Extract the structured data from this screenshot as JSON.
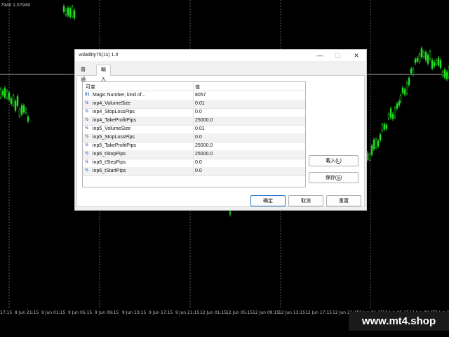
{
  "chart": {
    "top_info": "7940 1.07949",
    "time_labels": [
      "17:15",
      "8 Jun 21:15",
      "9 Jun 01:15",
      "9 Jun 05:15",
      "9 Jun 09:15",
      "9 Jun 13:15",
      "9 Jun 17:15",
      "9 Jun 21:15",
      "12 Jun 01:15",
      "12 Jun 05:15",
      "12 Jun 09:15",
      "12 Jun 13:15",
      "12 Jun 17:15",
      "12 Jun 21:15",
      "13 Jun 01:15",
      "13 Jun 05:15",
      "13 Jun 09:15",
      "13 Jun 13:15"
    ],
    "watermark": "www.mt4.shop",
    "candle_color": "#22dd22"
  },
  "dialog": {
    "title": "volatility75(1s) 1.0",
    "window_controls": {
      "minimize": "—",
      "maximize": "☐",
      "close": "✕"
    },
    "tabs": [
      "普通",
      "輸入"
    ],
    "table": {
      "col_variable": "可变",
      "col_value": "值",
      "rows": [
        {
          "icon": "01",
          "name": "Magic Number, kind of...",
          "value": "8057"
        },
        {
          "icon": "½",
          "name": "inp4_VolumeSize",
          "value": "0.01"
        },
        {
          "icon": "½",
          "name": "inp4_StopLossPips",
          "value": "0.0"
        },
        {
          "icon": "½",
          "name": "inp4_TakeProfitPips",
          "value": "25000.0"
        },
        {
          "icon": "½",
          "name": "inp5_VolumeSize",
          "value": "0.01"
        },
        {
          "icon": "½",
          "name": "inp5_StopLossPips",
          "value": "0.0"
        },
        {
          "icon": "½",
          "name": "inp5_TakeProfitPips",
          "value": "25000.0"
        },
        {
          "icon": "½",
          "name": "inp6_tStopPips",
          "value": "25000.0"
        },
        {
          "icon": "½",
          "name": "inp6_tStepPips",
          "value": "0.0"
        },
        {
          "icon": "½",
          "name": "inp6_tStartPips",
          "value": "0.0"
        }
      ]
    },
    "buttons": {
      "load_prefix": "載入(",
      "load_key": "L",
      "load_suffix": ")",
      "save_prefix": "保存(",
      "save_key": "S",
      "save_suffix": ")",
      "ok": "确定",
      "cancel": "取消",
      "reset": "重置"
    }
  }
}
